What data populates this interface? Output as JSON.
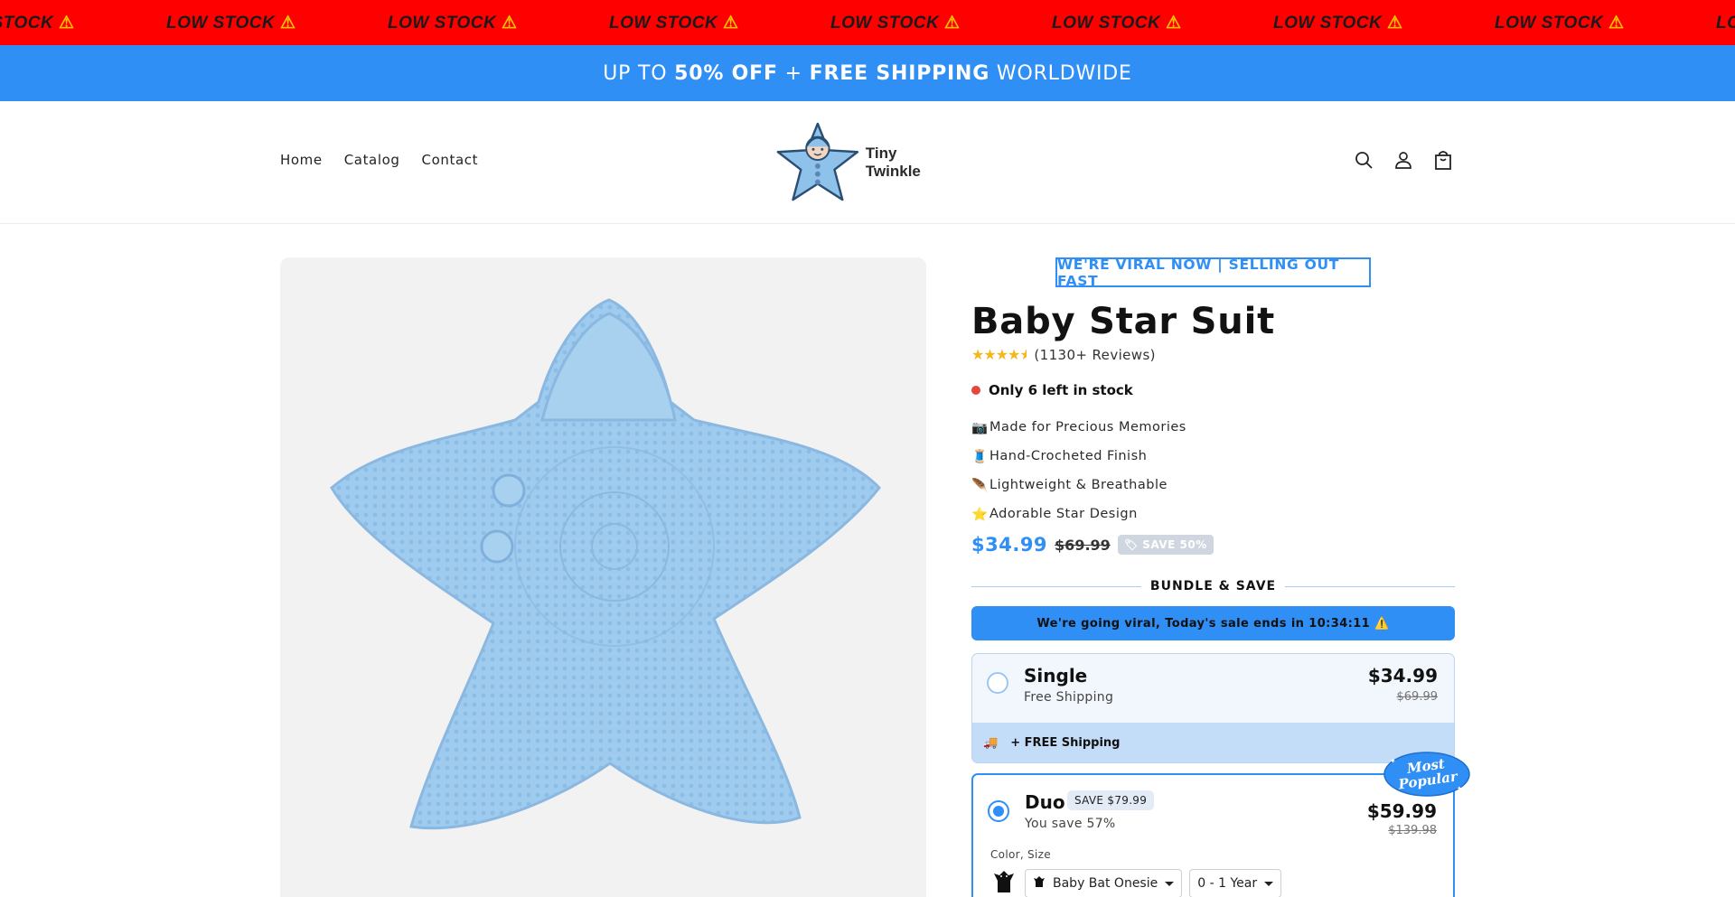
{
  "marquee": {
    "items": [
      "LOW STOCK",
      "LOW STOCK",
      "LOW STOCK",
      "LOW STOCK",
      "LOW STOCK",
      "LOW STOCK",
      "LOW STOCK",
      "LOW STOCK",
      "LOW STOCK"
    ],
    "icon": "warning-icon"
  },
  "announcement": {
    "prefix": "UP TO",
    "discount": "50% OFF",
    "plus": "+",
    "shipping": "FREE SHIPPING",
    "suffix": "WORLDWIDE"
  },
  "header": {
    "nav": [
      "Home",
      "Catalog",
      "Contact"
    ],
    "logo_text": "Tiny Twinkle",
    "icons": [
      "search-icon",
      "account-icon",
      "cart-icon"
    ]
  },
  "product": {
    "badge": "WE'RE VIRAL NOW | SELLING OUT FAST",
    "title": "Baby Star Suit",
    "rating_stars": 4.5,
    "reviews": "(1130+ Reviews)",
    "stock": "Only 6 left in stock",
    "features": [
      {
        "icon": "camera-icon",
        "text": "Made for Precious Memories"
      },
      {
        "icon": "thread-icon",
        "text": "Hand-Crocheted Finish"
      },
      {
        "icon": "feather-icon",
        "text": "Lightweight & Breathable"
      },
      {
        "icon": "star-icon",
        "text": "Adorable Star Design"
      }
    ],
    "price": "$34.99",
    "compare_price": "$69.99",
    "save_label": "SAVE 50%"
  },
  "bundle": {
    "heading": "BUNDLE & SAVE",
    "banner": "We're going viral, Today's sale ends in 10:34:11 ⚠️",
    "options": [
      {
        "name": "Single",
        "subtitle": "Free Shipping",
        "price": "$34.99",
        "compare": "$69.99",
        "perk": "+ FREE Shipping",
        "selected": false
      },
      {
        "name": "Duo",
        "badge": "SAVE $79.99",
        "subtitle": "You save 57%",
        "price": "$59.99",
        "compare": "$139.98",
        "ribbon": "Most Popular",
        "variant_label": "Color, Size",
        "variant_color": "Baby Bat Onesie",
        "variant_size": "0 - 1 Year",
        "selected": true
      }
    ]
  },
  "colors": {
    "marquee_bg": "#ff0000",
    "accent": "#2f8ff5",
    "stock_dot": "#e9443f",
    "star": "#f3b81c"
  }
}
